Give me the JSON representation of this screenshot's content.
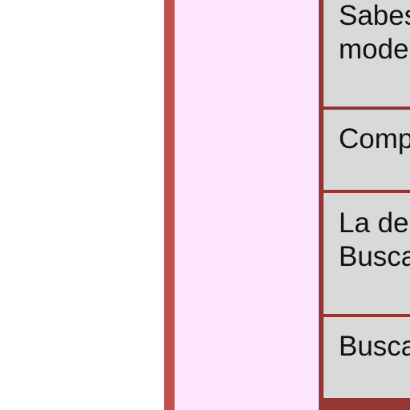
{
  "cells": [
    {
      "text": "Sabes\nmode"
    },
    {
      "text": "Comp"
    },
    {
      "text": "La de\nBusca"
    },
    {
      "text": "Busca"
    }
  ],
  "colors": {
    "left_bar": "#c0504d",
    "pink_column": "#fde6fd",
    "table_border": "#943634",
    "cell_background": "#d9d9d9"
  }
}
